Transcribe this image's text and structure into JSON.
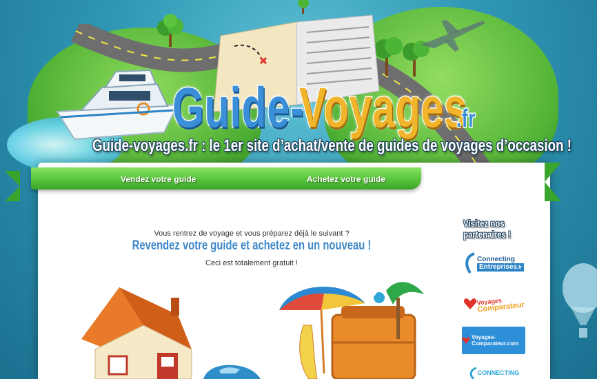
{
  "site": {
    "logo": {
      "part1": "Guide-",
      "part2": "Voyages",
      "tld": ".fr"
    },
    "tagline": "Guide-voyages.fr : le 1er site d’achat/vente de guides de voyages d’occasion !"
  },
  "nav": {
    "items": [
      {
        "label": "Vendez votre guide"
      },
      {
        "label": "Achetez votre guide"
      }
    ]
  },
  "intro": {
    "line1": "Vous rentrez de voyage et vous préparez déjà le suivant ?",
    "line2": "Revendez votre guide et achetez en un nouveau !",
    "line3": "Ceci est totalement gratuit !"
  },
  "partners": {
    "title": "Visitez nos partenaires !",
    "items": [
      {
        "name": "Connecting Entreprises",
        "line1": "Connecting",
        "line2": "Entreprises",
        "suffix": ".fr",
        "icon": "swirl-icon"
      },
      {
        "name": "Voyages Comparateur",
        "line1": "Voyages",
        "line2": "Comparateur",
        "icon": "heart-plane-icon"
      },
      {
        "name": "Voyages-Comparateur.com",
        "text": "Voyages-Comparateur.com",
        "icon": "heart-plane-icon"
      },
      {
        "name": "Connecting",
        "text": "CONNECTING",
        "icon": "swirl-icon"
      }
    ]
  },
  "colors": {
    "sky": "#2f97b4",
    "nav_green": "#58c33c",
    "logo_blue": "#3a8fd8",
    "logo_orange": "#f0b52a",
    "intro_blue": "#3f88c8"
  }
}
